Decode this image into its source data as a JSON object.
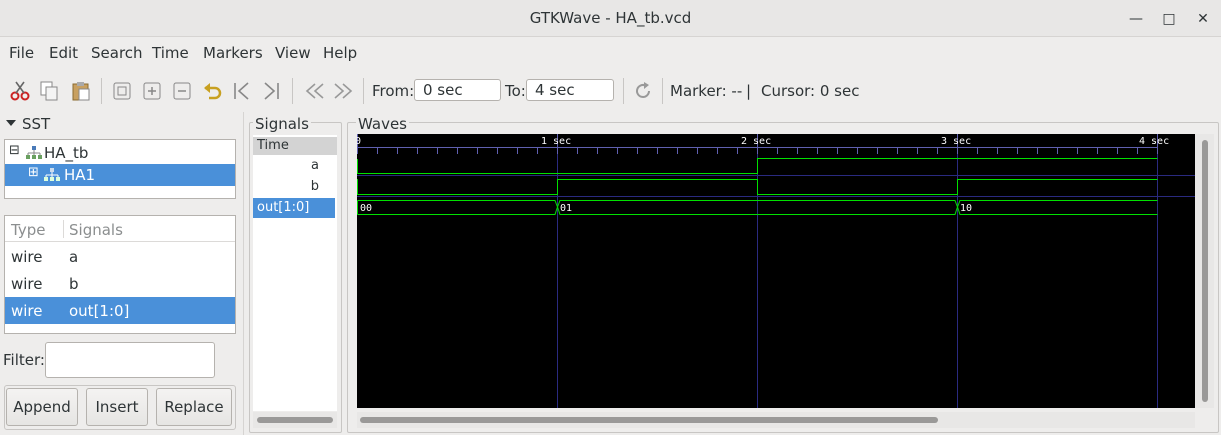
{
  "window": {
    "title": "GTKWave - HA_tb.vcd",
    "minimize": "—",
    "maximize": "□",
    "close": "✕"
  },
  "menu": [
    "File",
    "Edit",
    "Search",
    "Time",
    "Markers",
    "View",
    "Help"
  ],
  "toolbar": {
    "from_label": "From:",
    "from_value": "0 sec",
    "to_label": "To:",
    "to_value": "4 sec",
    "marker": "Marker: --",
    "divider": "|",
    "cursor": "Cursor: 0 sec"
  },
  "sst": {
    "label": "SST",
    "tree": [
      {
        "label": "HA_tb",
        "expander": "⊟"
      },
      {
        "label": "HA1",
        "expander": "⊞"
      }
    ],
    "columns": {
      "type": "Type",
      "signals": "Signals"
    },
    "rows": [
      {
        "type": "wire",
        "signal": "a"
      },
      {
        "type": "wire",
        "signal": "b"
      },
      {
        "type": "wire",
        "signal": "out[1:0]"
      }
    ]
  },
  "filter": {
    "label": "Filter:",
    "value": ""
  },
  "buttons": {
    "append": "Append",
    "insert": "Insert",
    "replace": "Replace"
  },
  "signals_panel": {
    "label": "Signals",
    "time": "Time",
    "names": [
      "a",
      "b",
      "out[1:0]"
    ]
  },
  "waves_panel": {
    "label": "Waves",
    "ticks": [
      "0",
      "1 sec",
      "2 sec",
      "3 sec",
      "4 sec"
    ],
    "bus_values": [
      "00",
      "01",
      "10"
    ]
  },
  "colors": {
    "selection": "#4a90d9",
    "wave": "#00e000",
    "grid": "#2a2a80",
    "background": "#000000"
  }
}
